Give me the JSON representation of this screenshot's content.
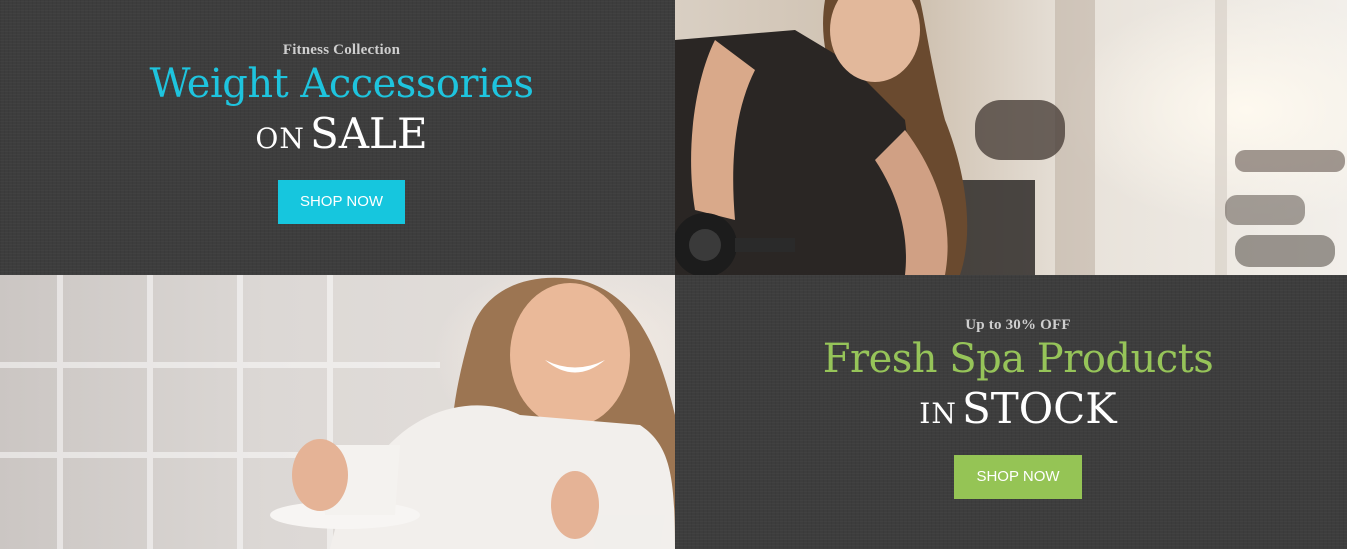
{
  "promo_weights": {
    "kicker": "Fitness Collection",
    "headline": "Weight Accessories",
    "sub_small": "ON",
    "sub_big": "SALE",
    "button_label": "SHOP NOW",
    "accent_color": "#1ec4de"
  },
  "promo_spa": {
    "kicker": "Up to 30% OFF",
    "headline": "Fresh Spa Products",
    "sub_small": "IN",
    "sub_big": "STOCK",
    "button_label": "SHOP NOW",
    "accent_color": "#96c459"
  },
  "images": {
    "gym": "woman-lifting-dumbbell-photo",
    "spa": "smiling-woman-in-bathrobe-with-cup-photo"
  }
}
